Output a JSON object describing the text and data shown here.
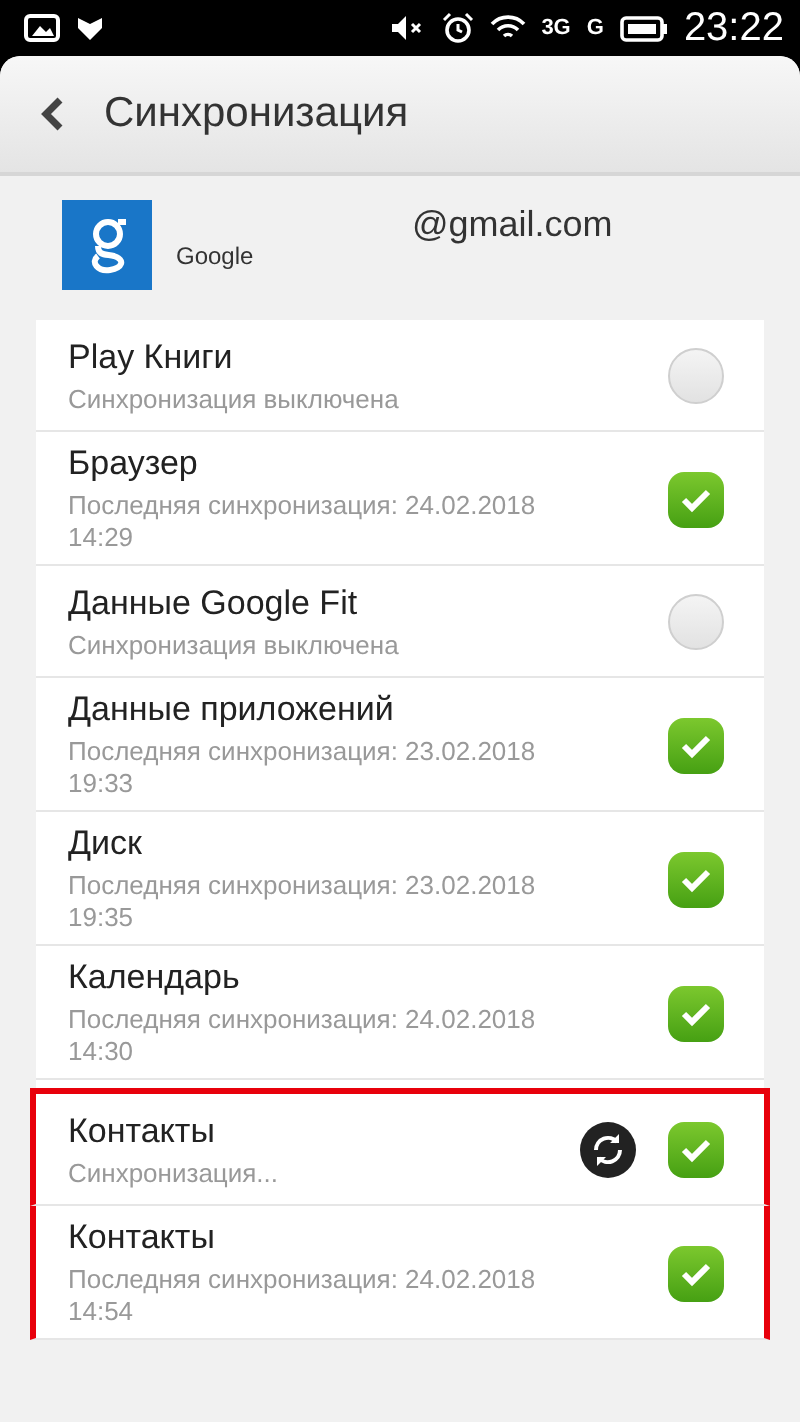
{
  "status_bar": {
    "time": "23:22",
    "network_1": "3G",
    "network_2": "G"
  },
  "header": {
    "title": "Синхронизация"
  },
  "account": {
    "email": "@gmail.com",
    "provider": "Google"
  },
  "items": [
    {
      "title": "Play Книги",
      "subtitle": "Синхронизация выключена",
      "checked": false,
      "syncing": false,
      "highlighted": false
    },
    {
      "title": "Браузер",
      "subtitle": "Последняя синхронизация: 24.02.2018\n14:29",
      "checked": true,
      "syncing": false,
      "highlighted": false
    },
    {
      "title": "Данные Google Fit",
      "subtitle": "Синхронизация выключена",
      "checked": false,
      "syncing": false,
      "highlighted": false
    },
    {
      "title": "Данные приложений",
      "subtitle": "Последняя синхронизация: 23.02.2018\n19:33",
      "checked": true,
      "syncing": false,
      "highlighted": false
    },
    {
      "title": "Диск",
      "subtitle": "Последняя синхронизация: 23.02.2018\n19:35",
      "checked": true,
      "syncing": false,
      "highlighted": false
    },
    {
      "title": "Календарь",
      "subtitle": "Последняя синхронизация: 24.02.2018\n14:30",
      "checked": true,
      "syncing": false,
      "highlighted": false
    },
    {
      "title": "Контакты",
      "subtitle": "Синхронизация...",
      "checked": true,
      "syncing": true,
      "highlighted": true
    },
    {
      "title": "Контакты",
      "subtitle": "Последняя синхронизация: 24.02.2018\n14:54",
      "checked": true,
      "syncing": false,
      "highlighted": true
    }
  ]
}
